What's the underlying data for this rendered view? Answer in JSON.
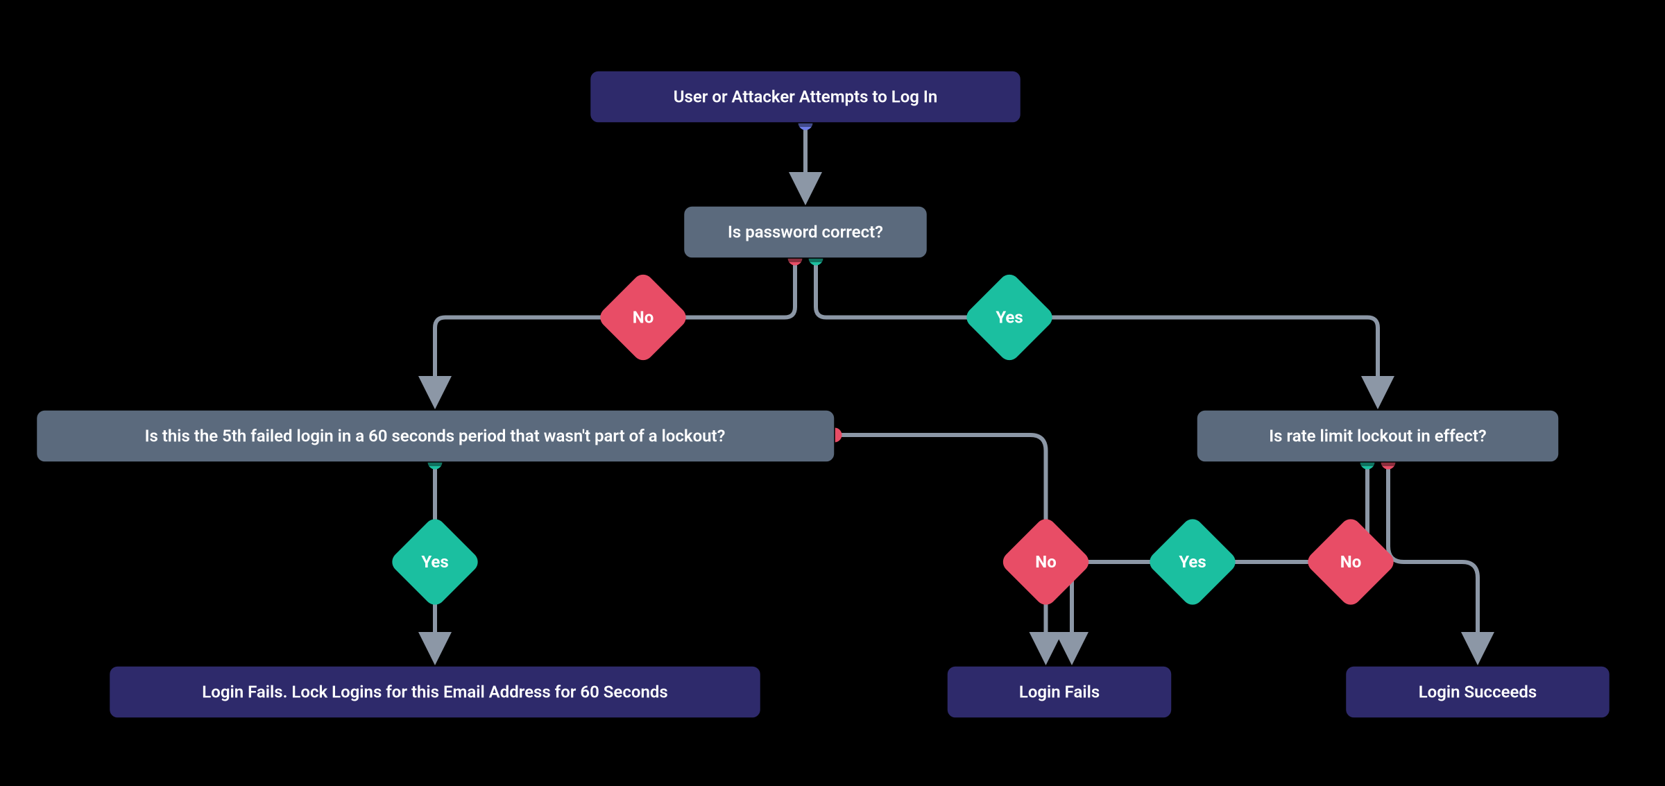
{
  "chart_data": {
    "type": "flowchart",
    "nodes": {
      "start": {
        "kind": "terminator",
        "label": "User or Attacker Attempts to Log In"
      },
      "q_pwd": {
        "kind": "decision",
        "label": "Is password correct?"
      },
      "q_5th": {
        "kind": "decision",
        "label": "Is this the 5th failed login in a 60 seconds period that wasn't part of a lockout?"
      },
      "q_lockout": {
        "kind": "decision",
        "label": "Is rate limit lockout in effect?"
      },
      "end_lock": {
        "kind": "terminator",
        "label": "Login Fails. Lock Logins for this Email Address for 60 Seconds"
      },
      "end_fails": {
        "kind": "terminator",
        "label": "Login Fails"
      },
      "end_succeeds": {
        "kind": "terminator",
        "label": "Login Succeeds"
      }
    },
    "edges": [
      {
        "from": "start",
        "to": "q_pwd",
        "label": null
      },
      {
        "from": "q_pwd",
        "to": "q_5th",
        "label": "No"
      },
      {
        "from": "q_pwd",
        "to": "q_lockout",
        "label": "Yes"
      },
      {
        "from": "q_5th",
        "to": "end_lock",
        "label": "Yes"
      },
      {
        "from": "q_5th",
        "to": "end_fails",
        "label": "No"
      },
      {
        "from": "q_lockout",
        "to": "end_fails",
        "label": "Yes"
      },
      {
        "from": "q_lockout",
        "to": "end_succeeds",
        "label": "No"
      }
    ],
    "labels": {
      "yes": "Yes",
      "no": "No"
    },
    "colors": {
      "terminator_fill": "#2e2a6b",
      "decision_fill": "#5b6a7d",
      "yes_fill": "#1bbfa0",
      "no_fill": "#e84d66",
      "edge_stroke": "#8c97a6",
      "start_dot": "#6d7ce6",
      "background": "#000000",
      "text": "#ffffff"
    }
  }
}
